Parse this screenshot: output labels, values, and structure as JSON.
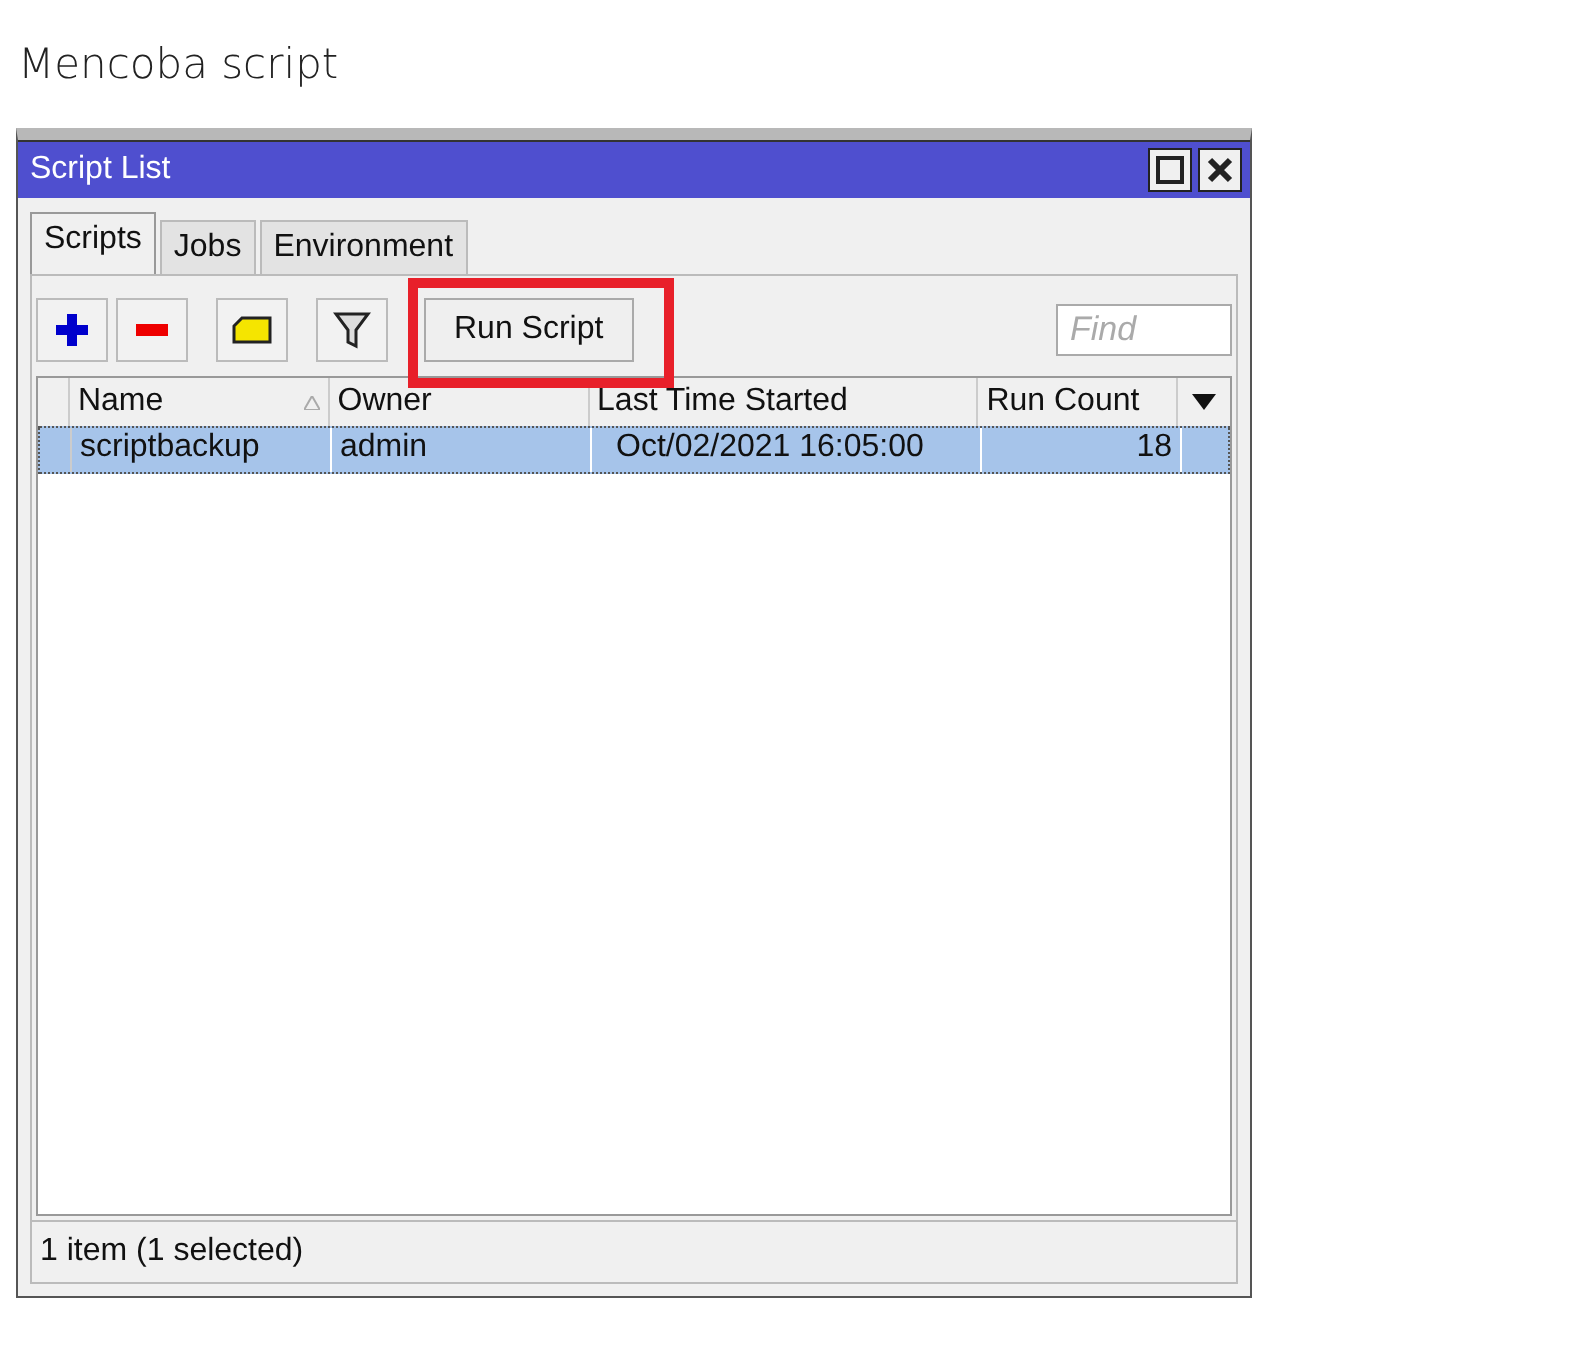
{
  "heading": "Mencoba script",
  "window": {
    "title": "Script List",
    "tabs": [
      {
        "label": "Scripts",
        "selected": true
      },
      {
        "label": "Jobs",
        "selected": false
      },
      {
        "label": "Environment",
        "selected": false
      }
    ],
    "toolbar": {
      "run_button": "Run Script",
      "highlighted": true,
      "search": {
        "placeholder": "Find"
      }
    },
    "table": {
      "columns": [
        {
          "label": "Name",
          "sorted": true
        },
        {
          "label": "Owner",
          "sorted": false
        },
        {
          "label": "Last Time Started",
          "sorted": false
        },
        {
          "label": "Run Count",
          "sorted": false
        }
      ],
      "rows": [
        {
          "cells": [
            "scriptbackup",
            "admin",
            "Oct/02/2021 16:05:00",
            "18"
          ],
          "selected": true
        }
      ]
    },
    "status_bar": "1 item (1 selected)"
  }
}
